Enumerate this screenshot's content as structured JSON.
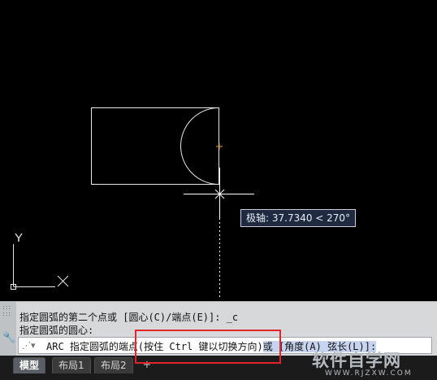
{
  "viewport": {
    "polar_tooltip": "极轴: 37.7340 < 270°",
    "ucs_y": "Y"
  },
  "command_line": {
    "history": [
      "指定圆弧的第二个点或 [圆心(C)/端点(E)]: _c",
      "指定圆弧的圆心:"
    ],
    "prompt_icon": "command-icon",
    "prompt_before": "ARC 指定圆弧的端点",
    "prompt_highlight": "(按住 Ctrl 键以切换方向)",
    "prompt_after": "或 [角度(A) 弦长(L)]:"
  },
  "layout_tabs": {
    "tabs": [
      "模型",
      "布局1",
      "布局2"
    ],
    "active_index": 0,
    "add_label": "+"
  },
  "watermark": {
    "main": "软件自学网",
    "sub": "WWW.RJZXW.COM"
  },
  "colors": {
    "background": "#000000",
    "geometry": "#ffffff",
    "snap_marker": "#e8a33a",
    "highlight_box": "#e3242b"
  }
}
